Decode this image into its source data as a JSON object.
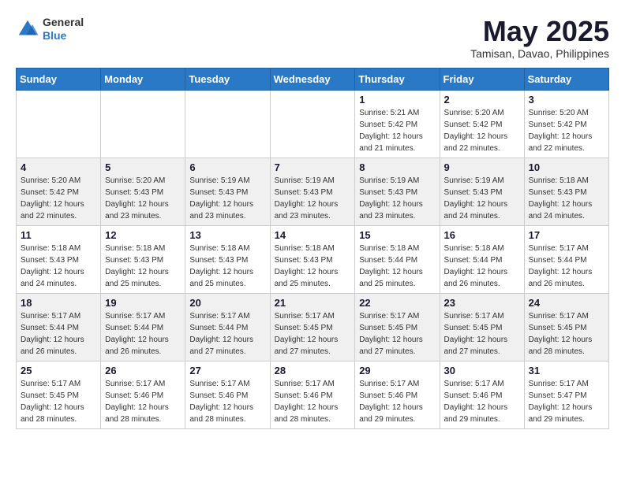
{
  "header": {
    "logo_line1": "General",
    "logo_line2": "Blue",
    "month": "May 2025",
    "location": "Tamisan, Davao, Philippines"
  },
  "days_of_week": [
    "Sunday",
    "Monday",
    "Tuesday",
    "Wednesday",
    "Thursday",
    "Friday",
    "Saturday"
  ],
  "weeks": [
    [
      {
        "day": "",
        "info": ""
      },
      {
        "day": "",
        "info": ""
      },
      {
        "day": "",
        "info": ""
      },
      {
        "day": "",
        "info": ""
      },
      {
        "day": "1",
        "info": "Sunrise: 5:21 AM\nSunset: 5:42 PM\nDaylight: 12 hours\nand 21 minutes."
      },
      {
        "day": "2",
        "info": "Sunrise: 5:20 AM\nSunset: 5:42 PM\nDaylight: 12 hours\nand 22 minutes."
      },
      {
        "day": "3",
        "info": "Sunrise: 5:20 AM\nSunset: 5:42 PM\nDaylight: 12 hours\nand 22 minutes."
      }
    ],
    [
      {
        "day": "4",
        "info": "Sunrise: 5:20 AM\nSunset: 5:42 PM\nDaylight: 12 hours\nand 22 minutes."
      },
      {
        "day": "5",
        "info": "Sunrise: 5:20 AM\nSunset: 5:43 PM\nDaylight: 12 hours\nand 23 minutes."
      },
      {
        "day": "6",
        "info": "Sunrise: 5:19 AM\nSunset: 5:43 PM\nDaylight: 12 hours\nand 23 minutes."
      },
      {
        "day": "7",
        "info": "Sunrise: 5:19 AM\nSunset: 5:43 PM\nDaylight: 12 hours\nand 23 minutes."
      },
      {
        "day": "8",
        "info": "Sunrise: 5:19 AM\nSunset: 5:43 PM\nDaylight: 12 hours\nand 23 minutes."
      },
      {
        "day": "9",
        "info": "Sunrise: 5:19 AM\nSunset: 5:43 PM\nDaylight: 12 hours\nand 24 minutes."
      },
      {
        "day": "10",
        "info": "Sunrise: 5:18 AM\nSunset: 5:43 PM\nDaylight: 12 hours\nand 24 minutes."
      }
    ],
    [
      {
        "day": "11",
        "info": "Sunrise: 5:18 AM\nSunset: 5:43 PM\nDaylight: 12 hours\nand 24 minutes."
      },
      {
        "day": "12",
        "info": "Sunrise: 5:18 AM\nSunset: 5:43 PM\nDaylight: 12 hours\nand 25 minutes."
      },
      {
        "day": "13",
        "info": "Sunrise: 5:18 AM\nSunset: 5:43 PM\nDaylight: 12 hours\nand 25 minutes."
      },
      {
        "day": "14",
        "info": "Sunrise: 5:18 AM\nSunset: 5:43 PM\nDaylight: 12 hours\nand 25 minutes."
      },
      {
        "day": "15",
        "info": "Sunrise: 5:18 AM\nSunset: 5:44 PM\nDaylight: 12 hours\nand 25 minutes."
      },
      {
        "day": "16",
        "info": "Sunrise: 5:18 AM\nSunset: 5:44 PM\nDaylight: 12 hours\nand 26 minutes."
      },
      {
        "day": "17",
        "info": "Sunrise: 5:17 AM\nSunset: 5:44 PM\nDaylight: 12 hours\nand 26 minutes."
      }
    ],
    [
      {
        "day": "18",
        "info": "Sunrise: 5:17 AM\nSunset: 5:44 PM\nDaylight: 12 hours\nand 26 minutes."
      },
      {
        "day": "19",
        "info": "Sunrise: 5:17 AM\nSunset: 5:44 PM\nDaylight: 12 hours\nand 26 minutes."
      },
      {
        "day": "20",
        "info": "Sunrise: 5:17 AM\nSunset: 5:44 PM\nDaylight: 12 hours\nand 27 minutes."
      },
      {
        "day": "21",
        "info": "Sunrise: 5:17 AM\nSunset: 5:45 PM\nDaylight: 12 hours\nand 27 minutes."
      },
      {
        "day": "22",
        "info": "Sunrise: 5:17 AM\nSunset: 5:45 PM\nDaylight: 12 hours\nand 27 minutes."
      },
      {
        "day": "23",
        "info": "Sunrise: 5:17 AM\nSunset: 5:45 PM\nDaylight: 12 hours\nand 27 minutes."
      },
      {
        "day": "24",
        "info": "Sunrise: 5:17 AM\nSunset: 5:45 PM\nDaylight: 12 hours\nand 28 minutes."
      }
    ],
    [
      {
        "day": "25",
        "info": "Sunrise: 5:17 AM\nSunset: 5:45 PM\nDaylight: 12 hours\nand 28 minutes."
      },
      {
        "day": "26",
        "info": "Sunrise: 5:17 AM\nSunset: 5:46 PM\nDaylight: 12 hours\nand 28 minutes."
      },
      {
        "day": "27",
        "info": "Sunrise: 5:17 AM\nSunset: 5:46 PM\nDaylight: 12 hours\nand 28 minutes."
      },
      {
        "day": "28",
        "info": "Sunrise: 5:17 AM\nSunset: 5:46 PM\nDaylight: 12 hours\nand 28 minutes."
      },
      {
        "day": "29",
        "info": "Sunrise: 5:17 AM\nSunset: 5:46 PM\nDaylight: 12 hours\nand 29 minutes."
      },
      {
        "day": "30",
        "info": "Sunrise: 5:17 AM\nSunset: 5:46 PM\nDaylight: 12 hours\nand 29 minutes."
      },
      {
        "day": "31",
        "info": "Sunrise: 5:17 AM\nSunset: 5:47 PM\nDaylight: 12 hours\nand 29 minutes."
      }
    ]
  ]
}
